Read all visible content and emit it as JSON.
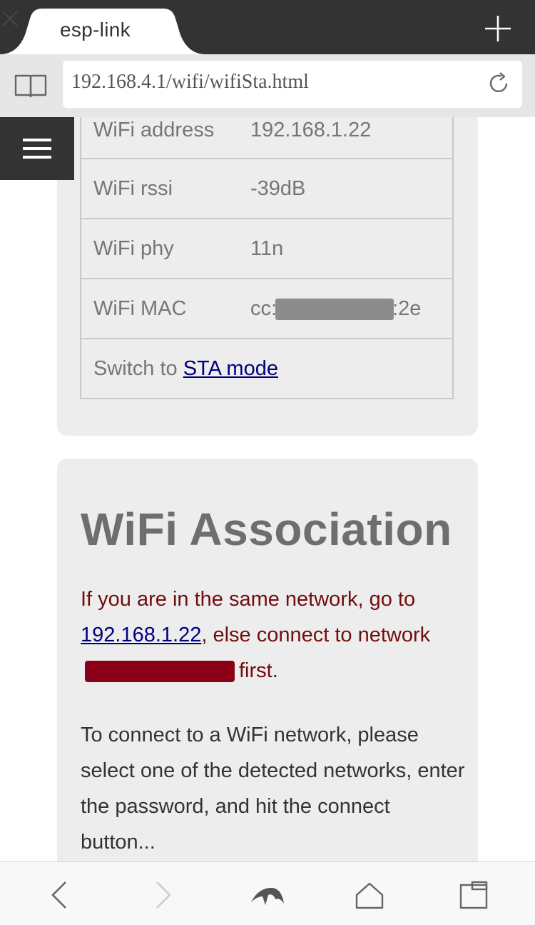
{
  "browser": {
    "tab_title": "esp-link",
    "url": "192.168.4.1/wifi/wifiSta.html"
  },
  "info_table": [
    {
      "label": "WiFi address",
      "value": "192.168.1.22"
    },
    {
      "label": "WiFi rssi",
      "value": "-39dB"
    },
    {
      "label": "WiFi phy",
      "value": "11n"
    },
    {
      "label": "WiFi MAC",
      "value_prefix": "cc:",
      "value_suffix": ":2e"
    }
  ],
  "switch_row": {
    "text": "Switch to ",
    "link": "STA mode"
  },
  "association": {
    "title": "WiFi Association",
    "msg_part1": "If you are in the same network, go to ",
    "msg_link": "192.168.1.22",
    "msg_part2": ", else connect to network",
    "msg_part3": "first.",
    "body": "To connect to a WiFi network, please select one of the detected networks, enter the password, and hit the connect button..."
  },
  "colors": {
    "accent_link": "#000080",
    "alert_text": "#730d0d",
    "redaction_red": "#8b0016"
  },
  "icons": [
    "reader-icon",
    "reload-icon",
    "close-icon",
    "plus-icon",
    "menu-icon",
    "back-icon",
    "forward-icon",
    "dolphin-icon",
    "home-icon",
    "tabs-icon"
  ]
}
